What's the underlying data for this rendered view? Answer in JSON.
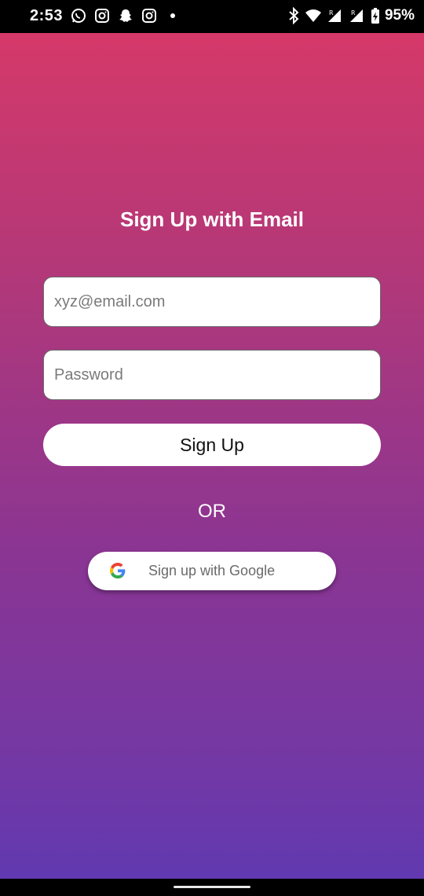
{
  "status_bar": {
    "time": "2:53",
    "battery_percent": "95%",
    "left_icons": [
      "whatsapp-icon",
      "instagram-icon",
      "snapchat-icon",
      "instagram-icon",
      "dot-icon"
    ],
    "right_icons": [
      "bluetooth-icon",
      "wifi-icon",
      "signal-r-icon",
      "signal-r-icon",
      "battery-charging-icon"
    ]
  },
  "form": {
    "title": "Sign Up with Email",
    "email_placeholder": "xyz@email.com",
    "password_placeholder": "Password",
    "signup_label": "Sign Up",
    "or_label": "OR",
    "google_label": "Sign up with Google"
  },
  "colors": {
    "gradient_top": "#d53969",
    "gradient_bottom": "#6139b0"
  }
}
